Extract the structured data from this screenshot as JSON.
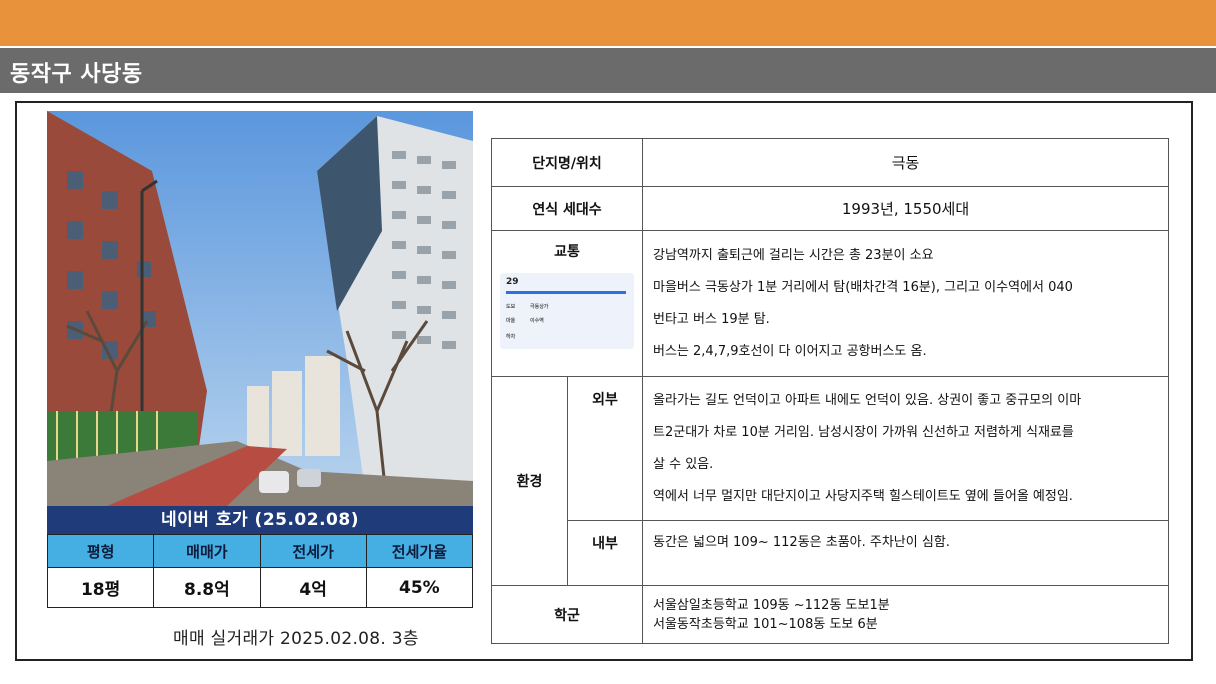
{
  "header": {
    "region": "동작구 사당동"
  },
  "price": {
    "title": "네이버 호가 (25.02.08)",
    "columns": [
      "평형",
      "매매가",
      "전세가",
      "전세가율"
    ],
    "values": [
      "18평",
      "8.8억",
      "4억",
      "45%"
    ]
  },
  "caption": "매매 실거래가 2025.02.08. 3층",
  "info": {
    "name_label": "단지명/위치",
    "name_value": "극동",
    "year_label": "연식 세대수",
    "year_value": "1993년, 1550세대",
    "transit_label": "교통",
    "transit_lines": [
      "강남역까지 출퇴근에 걸리는 시간은 총 23분이 소요",
      "마을버스 극동상가 1분 거리에서 탐(배차간격 16분), 그리고 이수역에서 040",
      "번타고 버스 19분 탐.",
      "버스는 2,4,7,9호선이 다 이어지고 공항버스도 옴."
    ],
    "env_label": "환경",
    "ext_label": "외부",
    "ext_lines": [
      "올라가는 길도 언덕이고 아파트 내에도 언덕이 있음.  상권이 좋고 중규모의 이마",
      "트2군대가 차로 10분 거리임. 남성시장이 가까워 신선하고 저렴하게 식재료를",
      "살 수 있음.",
      "역에서 너무 멀지만 대단지이고 사당지주택 힐스테이트도 옆에 들어올 예정임."
    ],
    "int_label": "내부",
    "int_lines": [
      "동간은 넓으며  109~ 112동은 초품아. 주차난이 심함."
    ],
    "school_label": "학군",
    "school_lines": [
      "서울삼일초등학교 109동 ~112동 도보1분",
      "서울동작초등학교 101~108동 도보 6분"
    ]
  },
  "transit_card": {
    "time": "29",
    "labels": [
      "도보",
      "극동상가",
      "마을",
      "이수역",
      "하차"
    ]
  }
}
